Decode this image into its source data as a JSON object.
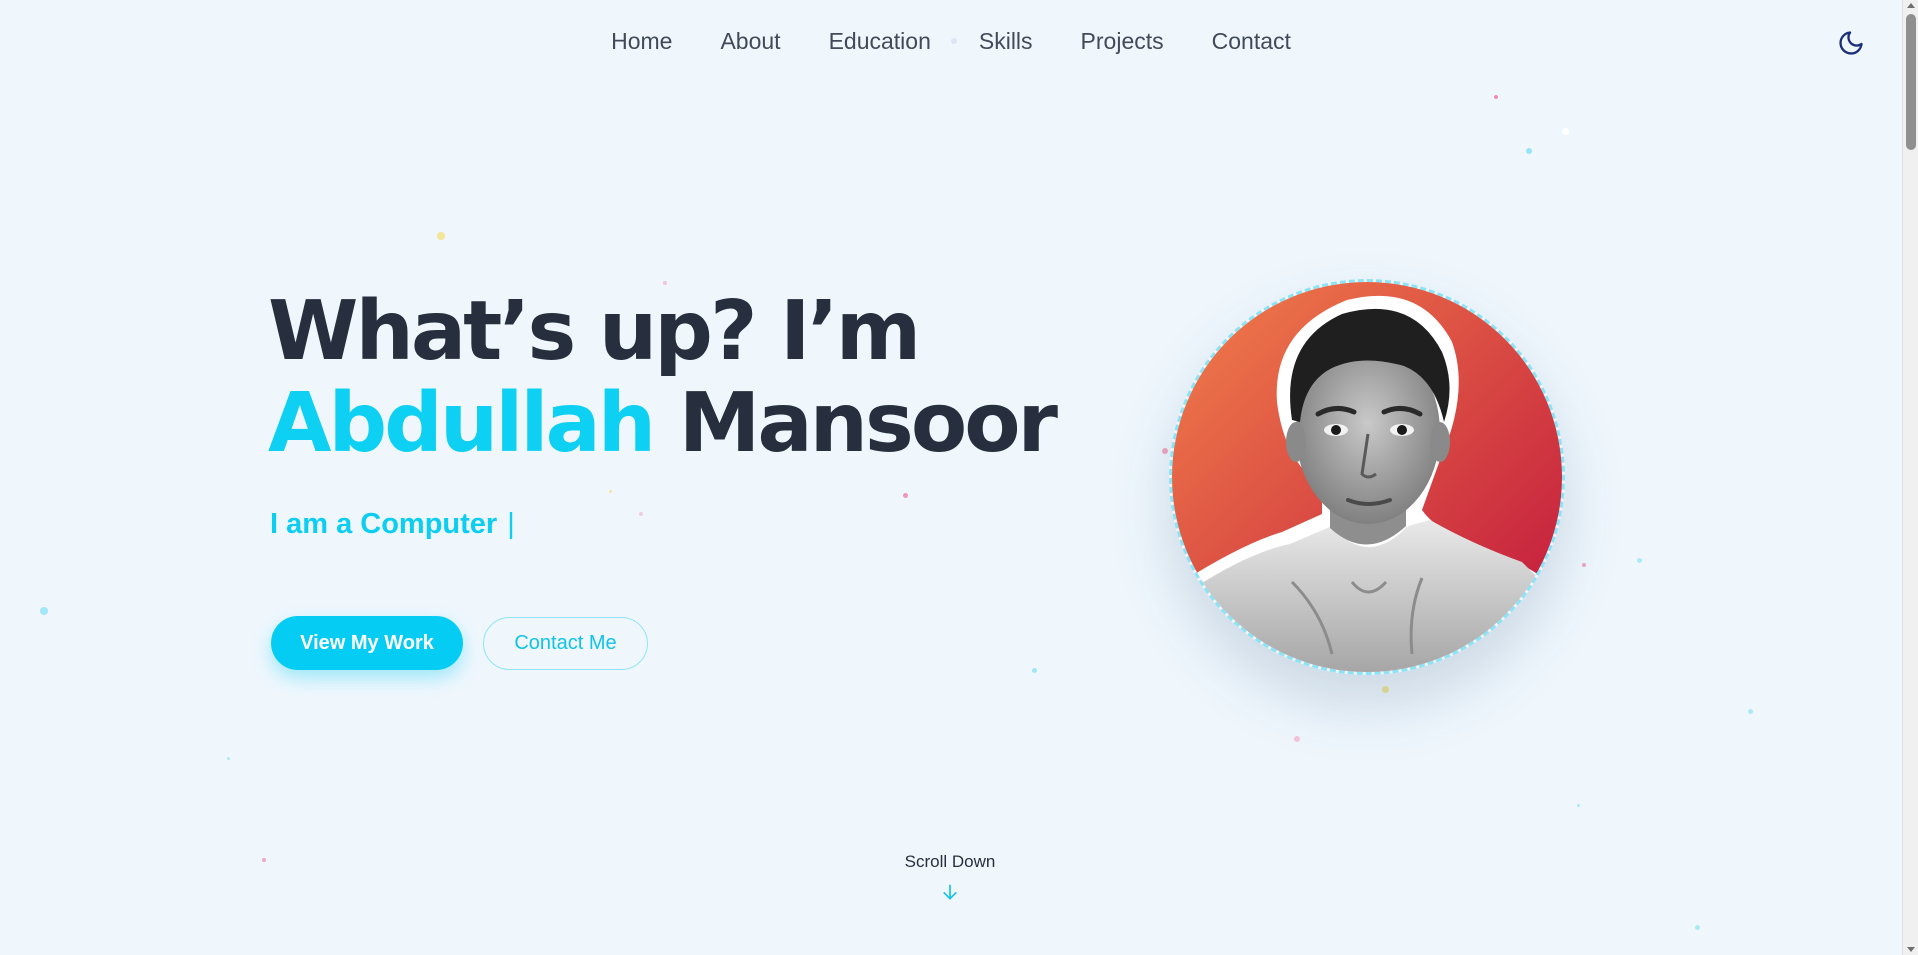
{
  "nav": {
    "items": [
      {
        "label": "Home"
      },
      {
        "label": "About"
      },
      {
        "label": "Education"
      },
      {
        "label": "Skills"
      },
      {
        "label": "Projects"
      },
      {
        "label": "Contact"
      }
    ],
    "theme_icon": "moon-icon"
  },
  "hero": {
    "greeting": "What’s up? I’m",
    "first_name": "Abdullah",
    "last_name": "Mansoor",
    "subtitle": "I am a Computer",
    "cursor": "|",
    "primary_button": "View My Work",
    "secondary_button": "Contact Me"
  },
  "scroll": {
    "label": "Scroll Down",
    "icon": "arrow-down-icon"
  },
  "colors": {
    "accent": "#05ccf3",
    "background": "#eff7fd",
    "text": "#272f3e",
    "avatar_gradient_start": "#f2804a",
    "avatar_gradient_end": "#c0143c"
  }
}
